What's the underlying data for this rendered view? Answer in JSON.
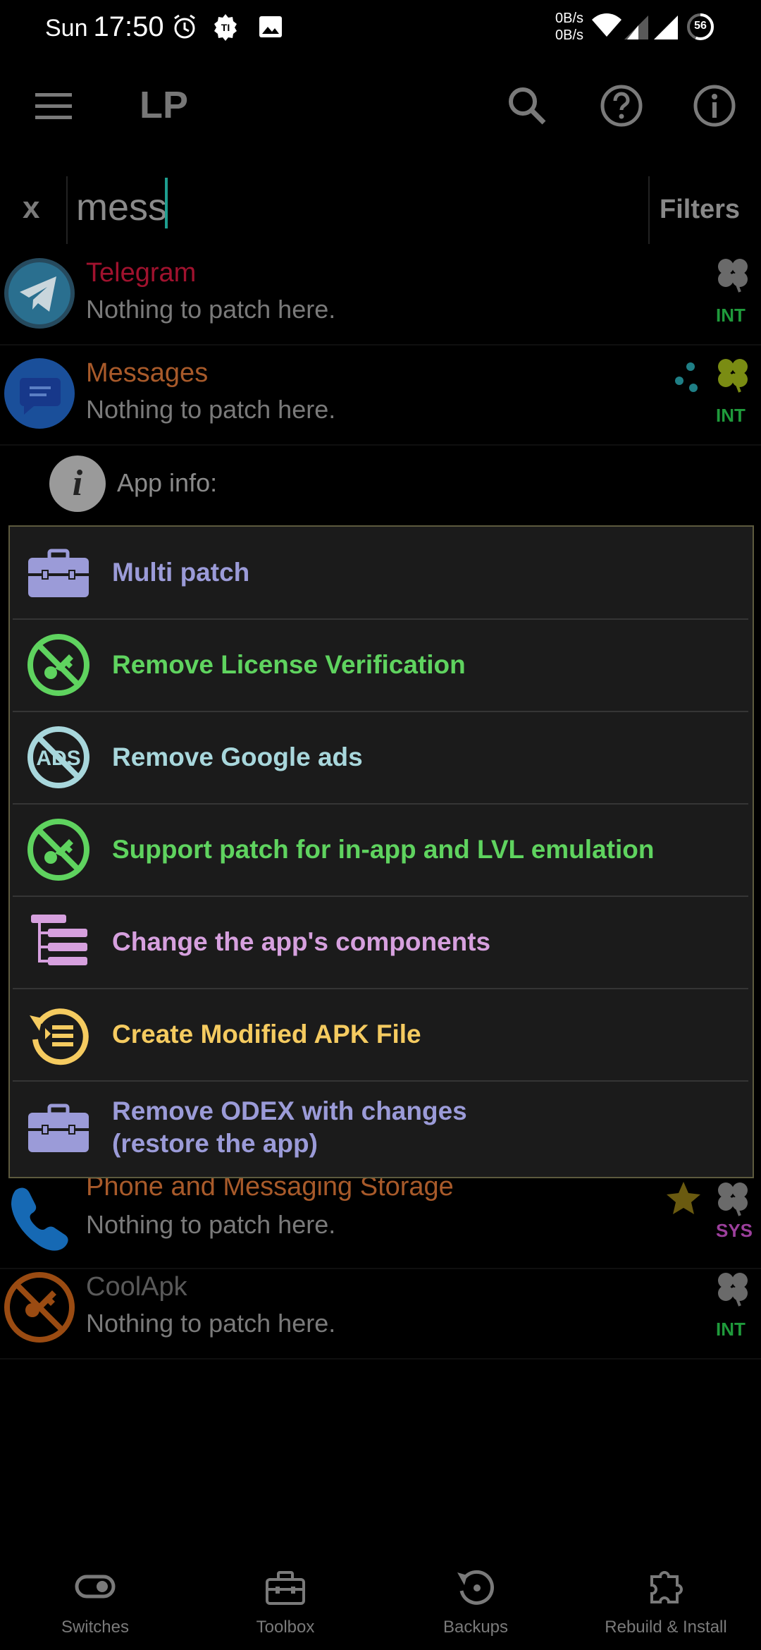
{
  "status_bar": {
    "day": "Sun",
    "time": "17:50",
    "net_up": "0B/s",
    "net_down": "0B/s",
    "battery": "56"
  },
  "toolbar": {
    "title": "LP"
  },
  "search": {
    "clear_label": "x",
    "query": "mess",
    "filters_label": "Filters"
  },
  "apps_top": [
    {
      "name": "Telegram",
      "status": "Nothing to patch here.",
      "badge": "INT",
      "name_color": "#a0122e",
      "badge_color": "#1f9a3b"
    },
    {
      "name": "Messages",
      "status": "Nothing to patch here.",
      "badge": "INT",
      "name_color": "#a85a2a",
      "badge_color": "#1f9a3b"
    }
  ],
  "app_info": {
    "label": "App info:"
  },
  "menu": {
    "items": [
      {
        "label": "Multi patch",
        "color": "#9b9bd8",
        "icon": "toolbox-icon"
      },
      {
        "label": "Remove License Verification",
        "color": "#5fd35f",
        "icon": "no-key-icon"
      },
      {
        "label": "Remove Google ads",
        "color": "#a8d7dc",
        "icon": "no-ads-icon"
      },
      {
        "label": "Support patch for in-app and LVL emulation",
        "color": "#5fd35f",
        "icon": "no-key-icon"
      },
      {
        "label": "Change the app's components",
        "color": "#d6a0de",
        "icon": "components-icon"
      },
      {
        "label": "Create Modified APK File",
        "color": "#f5cb60",
        "icon": "rebuild-icon"
      },
      {
        "label": "Remove ODEX with changes\n(restore the app)",
        "color": "#9b9bd8",
        "icon": "toolbox-icon"
      }
    ]
  },
  "apps_bottom": [
    {
      "name": "Phone and Messaging Storage",
      "status": "Nothing to patch here.",
      "badge": "SYS",
      "name_color": "#a85a2a",
      "badge_color": "#9c3f9c"
    },
    {
      "name": "CoolApk",
      "status": "Nothing to patch here.",
      "badge": "INT",
      "name_color": "#5a5a5a",
      "badge_color": "#1f9a3b"
    }
  ],
  "bottom_nav": {
    "items": [
      {
        "label": "Switches",
        "icon": "toggle-icon"
      },
      {
        "label": "Toolbox",
        "icon": "toolbox-icon"
      },
      {
        "label": "Backups",
        "icon": "backup-icon"
      },
      {
        "label": "Rebuild & Install",
        "icon": "puzzle-icon"
      }
    ]
  }
}
